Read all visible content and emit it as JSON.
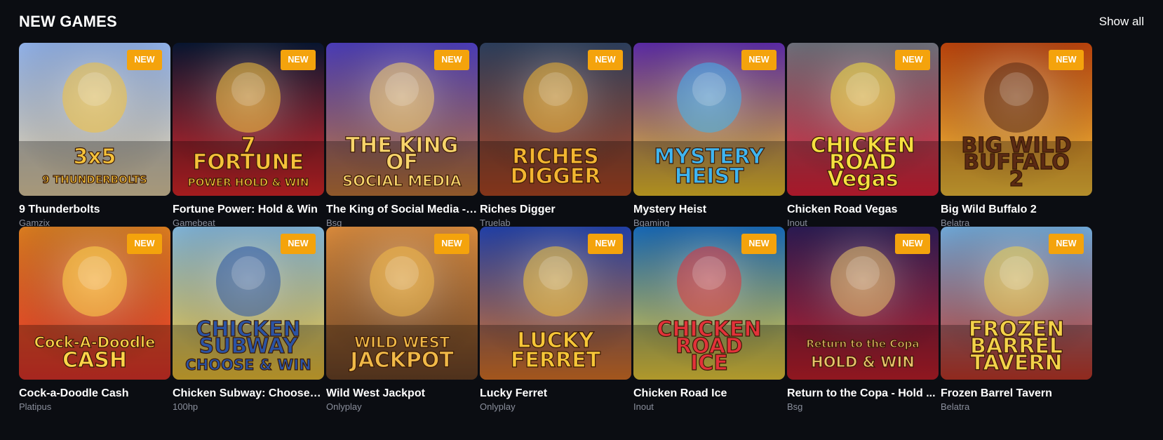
{
  "section": {
    "title": "NEW GAMES",
    "show_all": "Show all"
  },
  "badge_label": "NEW",
  "games": [
    {
      "name": "9 Thunderbolts",
      "provider": "Gamzix",
      "art_text": [
        "3x5",
        "9 THUNDERBOLTS"
      ],
      "icon": "zeus-art",
      "colors": [
        "#8fb0e8",
        "#e8d3a8",
        "#f5c23a"
      ]
    },
    {
      "name": "Fortune Power: Hold & Win",
      "provider": "Gamebeat",
      "art_text": [
        "7",
        "FORTUNE",
        "POWER HOLD & WIN"
      ],
      "icon": "fruit-seven-art",
      "colors": [
        "#071530",
        "#e3282a",
        "#f5c23a"
      ]
    },
    {
      "name": "The King of Social Media - ...",
      "provider": "Bsg",
      "art_text": [
        "THE KING",
        "OF",
        "SOCIAL MEDIA"
      ],
      "icon": "king-art",
      "colors": [
        "#4a3cb8",
        "#c77a3a",
        "#f7d46b"
      ]
    },
    {
      "name": "Riches Digger",
      "provider": "Truelab",
      "art_text": [
        "RICHES",
        "DIGGER"
      ],
      "icon": "dwarf-art",
      "colors": [
        "#2c3e5c",
        "#b64a24",
        "#f3b631"
      ]
    },
    {
      "name": "Mystery Heist",
      "provider": "Bgaming",
      "art_text": [
        "MYSTERY",
        "HEIST"
      ],
      "icon": "thief-art",
      "colors": [
        "#5b2aa6",
        "#f2c62a",
        "#3fb5f0"
      ]
    },
    {
      "name": "Chicken Road Vegas",
      "provider": "Inout",
      "art_text": [
        "CHICKEN",
        "ROAD",
        "Vegas"
      ],
      "icon": "chicken-art",
      "colors": [
        "#6c6f7a",
        "#e8223a",
        "#f5e040"
      ]
    },
    {
      "name": "Big Wild Buffalo 2",
      "provider": "Belatra",
      "art_text": [
        "BIG WILD",
        "BUFFALO",
        "2"
      ],
      "icon": "buffalo-art",
      "colors": [
        "#b8420c",
        "#f8c43c",
        "#5a2a14"
      ]
    },
    {
      "name": "Cock-a-Doodle Cash",
      "provider": "Platipus",
      "art_text": [
        "Cock-A-Doodle",
        "CASH"
      ],
      "icon": "rooster-art",
      "colors": [
        "#d97c1f",
        "#e7352b",
        "#ffd54a"
      ]
    },
    {
      "name": "Chicken Subway: Choose a...",
      "provider": "100hp",
      "art_text": [
        "CHICKEN",
        "SUBWAY",
        "CHOOSE & WIN"
      ],
      "icon": "subway-art",
      "colors": [
        "#7fb3d8",
        "#f3c435",
        "#2b53a3"
      ]
    },
    {
      "name": "Wild West Jackpot",
      "provider": "Onlyplay",
      "art_text": [
        "WILD WEST",
        "JACKPOT"
      ],
      "icon": "cowboy-art",
      "colors": [
        "#d98a3c",
        "#6e4528",
        "#f0b948"
      ]
    },
    {
      "name": "Lucky Ferret",
      "provider": "Onlyplay",
      "art_text": [
        "LUCKY",
        "FERRET"
      ],
      "icon": "ferret-art",
      "colors": [
        "#2140a8",
        "#e37828",
        "#f6c638"
      ]
    },
    {
      "name": "Chicken Road Ice",
      "provider": "Inout",
      "art_text": [
        "CHICKEN",
        "ROAD",
        "ICE"
      ],
      "icon": "ice-chicken-art",
      "colors": [
        "#1668b6",
        "#f4d33c",
        "#e2323a"
      ]
    },
    {
      "name": "Return to the Copa - Hold ...",
      "provider": "Bsg",
      "art_text": [
        "Return to the Copa",
        "HOLD & WIN"
      ],
      "icon": "copa-art",
      "colors": [
        "#2a1a52",
        "#c8202c",
        "#e8c36a"
      ]
    },
    {
      "name": "Frozen Barrel Tavern",
      "provider": "Belatra",
      "art_text": [
        "FROZEN",
        "BARREL",
        "TAVERN"
      ],
      "icon": "tavern-art",
      "colors": [
        "#6fa8d8",
        "#c83a2a",
        "#f3d24a"
      ]
    }
  ]
}
